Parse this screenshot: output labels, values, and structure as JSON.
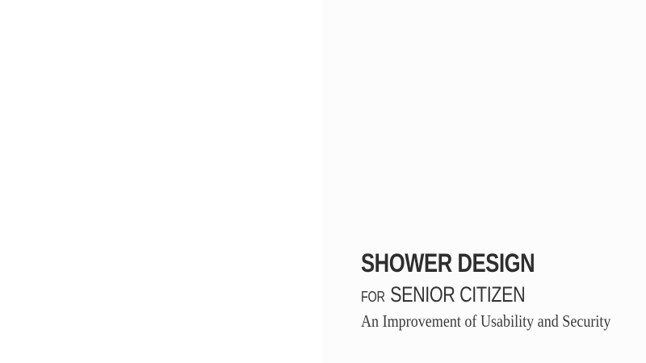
{
  "document": {
    "title": "SHOWER DESIGN",
    "subtitle_prefix": "FOR",
    "subtitle_main": "SENIOR CITIZEN",
    "tagline": "An Improvement of Usability and Security"
  },
  "colors": {
    "background": "#ffffff",
    "right_panel_background": "#fcfcfc",
    "text": "#2e2e2e"
  }
}
